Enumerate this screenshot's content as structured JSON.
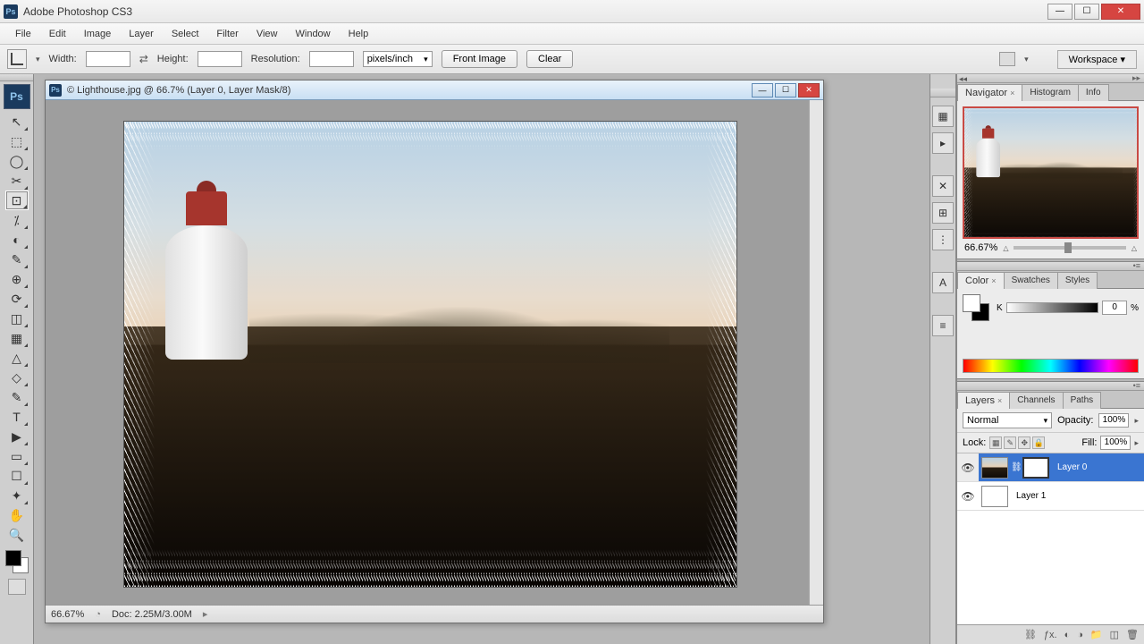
{
  "window": {
    "title": "Adobe Photoshop CS3"
  },
  "menu": [
    "File",
    "Edit",
    "Image",
    "Layer",
    "Select",
    "Filter",
    "View",
    "Window",
    "Help"
  ],
  "options": {
    "width_label": "Width:",
    "height_label": "Height:",
    "resolution_label": "Resolution:",
    "res_unit": "pixels/inch",
    "front_image": "Front Image",
    "clear": "Clear",
    "workspace": "Workspace"
  },
  "document": {
    "title": "© Lighthouse.jpg @ 66.7% (Layer 0, Layer Mask/8)",
    "zoom": "66.67%",
    "doc_size": "Doc: 2.25M/3.00M"
  },
  "panels": {
    "navigator": {
      "tabs": [
        "Navigator",
        "Histogram",
        "Info"
      ],
      "zoom": "66.67%"
    },
    "color": {
      "tabs": [
        "Color",
        "Swatches",
        "Styles"
      ],
      "channel": "K",
      "value": "0",
      "unit": "%"
    },
    "layers": {
      "tabs": [
        "Layers",
        "Channels",
        "Paths"
      ],
      "blend_mode": "Normal",
      "opacity_label": "Opacity:",
      "opacity": "100%",
      "lock_label": "Lock:",
      "fill_label": "Fill:",
      "fill": "100%",
      "items": [
        {
          "name": "Layer 0",
          "selected": true,
          "has_mask": true
        },
        {
          "name": "Layer 1",
          "selected": false,
          "has_mask": false
        }
      ]
    }
  },
  "tools": [
    "↖",
    "⬚",
    "◯",
    "✂",
    "⊡",
    "⁒",
    "✎",
    "⟋",
    "⟋",
    "⌗",
    "⌧",
    "⟡",
    "△",
    "◇",
    "✎",
    "T",
    "▶",
    "⬚",
    "↯",
    "⊕",
    "✋",
    "🔍"
  ],
  "dock_icons": [
    "▦",
    "▸",
    "✕",
    "⊞",
    "⋮",
    "A",
    "≡"
  ]
}
